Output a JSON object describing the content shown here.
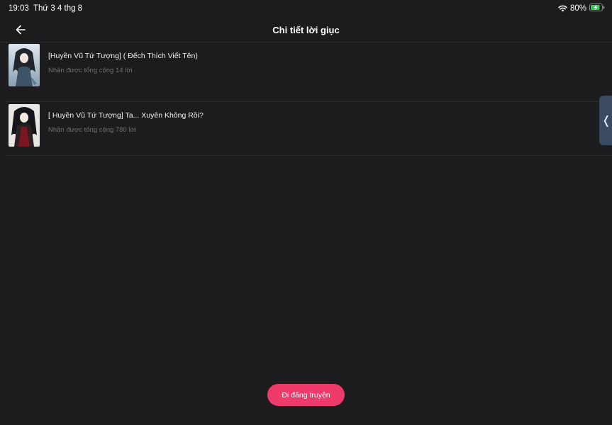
{
  "status_bar": {
    "time": "19:03",
    "date": "Thứ 3 4 thg 8",
    "battery_percent": "80%",
    "wifi_icon": "wifi-icon",
    "battery_icon": "battery-charging-icon"
  },
  "nav": {
    "title": "Chi tiết lời giục",
    "back_icon": "arrow-left-icon"
  },
  "stories": [
    {
      "title": "[Huyền Vũ Tứ Tượng] ( Đếch Thích Viết Tên)",
      "subtitle": "Nhận được tổng cộng 14 lời"
    },
    {
      "title": "[ Huyền Vũ Tứ Tượng] Ta... Xuyên Không Rồi?",
      "subtitle": "Nhận được tổng cộng 780 lời"
    }
  ],
  "side_tab": {
    "glyph": "❬",
    "icon": "chevron-left-icon"
  },
  "cta": {
    "label": "Đi đăng truyện"
  },
  "colors": {
    "background": "#1c1c1e",
    "accent": "#ef3a6c",
    "side_tab": "#3a4a60",
    "battery_green": "#34c759"
  }
}
